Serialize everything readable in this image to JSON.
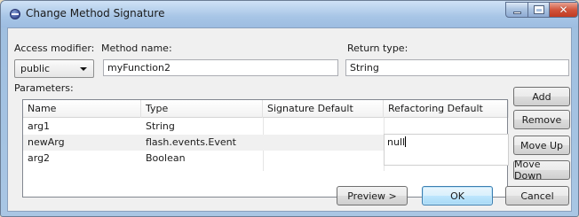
{
  "window": {
    "title": "Change Method Signature"
  },
  "labels": {
    "access_modifier": "Access modifier:",
    "method_name": "Method name:",
    "return_type": "Return type:",
    "parameters": "Parameters:"
  },
  "access_modifier": {
    "selected": "public"
  },
  "method_name": {
    "value": "myFunction2"
  },
  "return_type": {
    "value": "String"
  },
  "parameters_table": {
    "columns": [
      "Name",
      "Type",
      "Signature Default",
      "Refactoring Default"
    ],
    "rows": [
      {
        "name": "arg1",
        "type": "String",
        "signature_default": "",
        "refactoring_default": ""
      },
      {
        "name": "newArg",
        "type": "flash.events.Event",
        "signature_default": "",
        "refactoring_default": "null"
      },
      {
        "name": "arg2",
        "type": "Boolean",
        "signature_default": "",
        "refactoring_default": ""
      }
    ],
    "selected_row": 1
  },
  "buttons": {
    "add": "Add",
    "remove": "Remove",
    "move_up": "Move Up",
    "move_down": "Move Down",
    "preview": "Preview >",
    "ok": "OK",
    "cancel": "Cancel"
  },
  "icons": {
    "app": "eclipse-icon",
    "minimize": "minimize-icon",
    "maximize": "maximize-icon",
    "close": "close-icon",
    "dropdown": "chevron-down-icon"
  },
  "colors": {
    "title_bar": "#a7c5e6",
    "close_button": "#c03b22",
    "ok_border": "#3c7fb1"
  }
}
